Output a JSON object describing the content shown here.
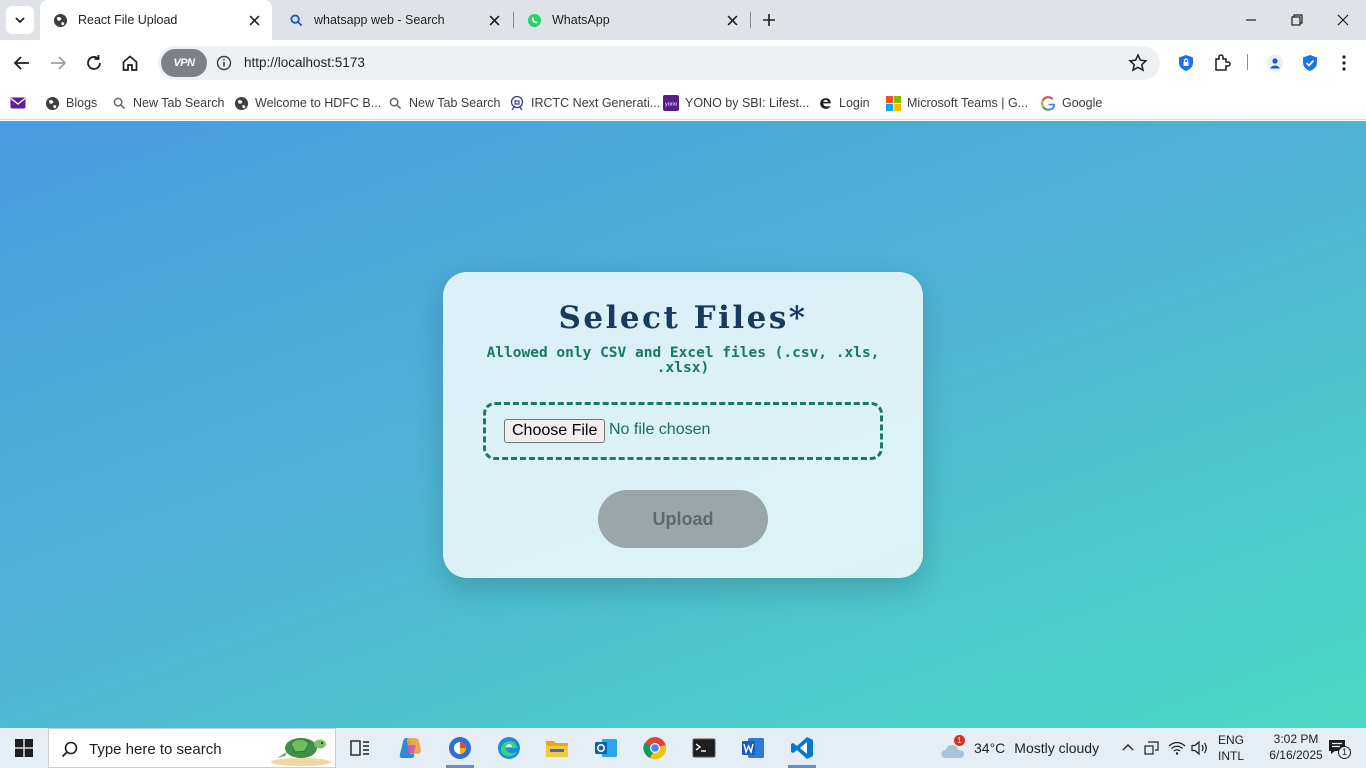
{
  "browser": {
    "tabs": [
      {
        "title": "React File Upload",
        "active": true
      },
      {
        "title": "whatsapp web - Search",
        "active": false
      },
      {
        "title": "WhatsApp",
        "active": false
      }
    ],
    "url": "http://localhost:5173",
    "vpn_label": "VPN"
  },
  "bookmarks": [
    {
      "label": "Blogs",
      "icon": "globe-icon"
    },
    {
      "label": "New Tab Search",
      "icon": "search-icon"
    },
    {
      "label": "Welcome to HDFC B...",
      "icon": "globe-icon"
    },
    {
      "label": "New Tab Search",
      "icon": "search-icon"
    },
    {
      "label": "IRCTC Next Generati...",
      "icon": "irctc-icon"
    },
    {
      "label": "YONO by SBI: Lifest...",
      "icon": "yono-icon"
    },
    {
      "label": "Login",
      "icon": "edge-e-icon"
    },
    {
      "label": "Microsoft Teams | G...",
      "icon": "microsoft-icon"
    },
    {
      "label": "Google",
      "icon": "google-icon"
    }
  ],
  "upload_card": {
    "title": "Select Files*",
    "subtitle": "Allowed only CSV and Excel files (.csv, .xls, .xlsx)",
    "choose_button": "Choose File",
    "no_file_text": "No file chosen",
    "upload_button": "Upload"
  },
  "taskbar": {
    "search_placeholder": "Type here to search",
    "weather_temp": "34°C",
    "weather_desc": "Mostly cloudy",
    "weather_badge": "1",
    "lang_top": "ENG",
    "lang_bottom": "INTL",
    "time": "3:02 PM",
    "date": "6/16/2025",
    "notification_count": "1"
  },
  "colors": {
    "gradient_start": "#4a9be0",
    "gradient_end": "#4cd9c4",
    "title_color": "#173a5e",
    "accent_green": "#17785c",
    "upload_disabled": "#9aa7a8"
  }
}
